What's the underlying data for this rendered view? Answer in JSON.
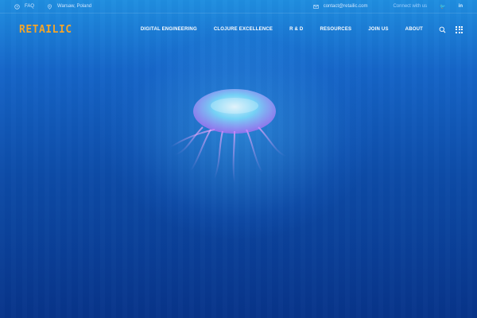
{
  "topbar": {
    "faq_label": "FAQ",
    "location": "Warsaw, Poland",
    "email": "contact@retailic.com",
    "connect_label": "Connect with us",
    "social": [
      {
        "icon": "twitter-icon",
        "text": "🐦"
      },
      {
        "icon": "linkedin-icon",
        "text": "in"
      }
    ]
  },
  "brand": {
    "logo": "RETAILIC",
    "logo_color": "#f2a52c"
  },
  "nav": {
    "items": [
      "DIGITAL ENGINEERING",
      "CLOJURE EXCELLENCE",
      "R & D",
      "RESOURCES",
      "JOIN US",
      "ABOUT"
    ]
  },
  "icons": {
    "search": "search-icon",
    "menu": "grid-menu-icon",
    "faq": "question-icon",
    "location": "location-pin-icon",
    "email": "envelope-icon"
  },
  "hero": {
    "image": "jellyfish",
    "background_color": "#0a3a8e"
  }
}
